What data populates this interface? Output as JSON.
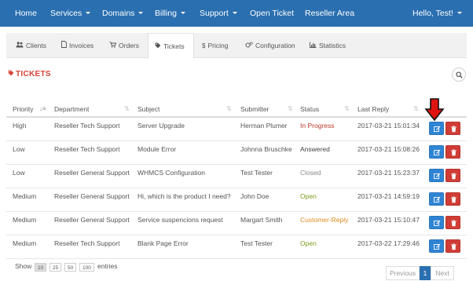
{
  "navbar": {
    "items": [
      {
        "label": "Home"
      },
      {
        "label": "Services"
      },
      {
        "label": "Domains"
      },
      {
        "label": "Billing"
      },
      {
        "label": "Support"
      },
      {
        "label": "Open Ticket"
      },
      {
        "label": "Reseller Area"
      }
    ],
    "user": "Hello, Test!",
    "color": "#2a6fb0"
  },
  "tabs": [
    {
      "label": "Clients",
      "icon": "users-icon"
    },
    {
      "label": "Invoices",
      "icon": "file-icon"
    },
    {
      "label": "Orders",
      "icon": "cart-icon"
    },
    {
      "label": "Tickets",
      "icon": "tag-icon",
      "active": true
    },
    {
      "label": "Pricing",
      "icon": "dollar-icon"
    },
    {
      "label": "Configuration",
      "icon": "cogs-icon"
    },
    {
      "label": "Statistics",
      "icon": "bar-chart-icon"
    }
  ],
  "section": {
    "title": "TICKETS",
    "title_icon": "tag-icon",
    "accent": "#d9433b"
  },
  "table": {
    "columns": [
      "Priority",
      "Department",
      "Subject",
      "Submitter",
      "Status",
      "Last Reply"
    ],
    "rows": [
      {
        "priority": "High",
        "department": "Reseller Tech Support",
        "subject": "Server Upgrade",
        "submitter": "Herman Plumer",
        "status": "In Progress",
        "last_reply": "2017-03-21 15:01:34"
      },
      {
        "priority": "Low",
        "department": "Reseller Tech Support",
        "subject": "Module Error",
        "submitter": "Johnna Bruschke",
        "status": "Answered",
        "last_reply": "2017-03-21 15:08:26"
      },
      {
        "priority": "Low",
        "department": "Reseller General Support",
        "subject": "WHMCS Configuration",
        "submitter": "Test Tester",
        "status": "Closed",
        "last_reply": "2017-03-21 15:23:37"
      },
      {
        "priority": "Medium",
        "department": "Reseller General Support",
        "subject": "Hi, which is the product I need?",
        "submitter": "John Doe",
        "status": "Open",
        "last_reply": "2017-03-21 14:59:19"
      },
      {
        "priority": "Medium",
        "department": "Reseller General Support",
        "subject": "Service suspencions request",
        "submitter": "Margart Smith",
        "status": "Customer-Reply",
        "last_reply": "2017-03-21 15:10:47"
      },
      {
        "priority": "Medium",
        "department": "Reseller Tech Support",
        "subject": "Blank Page Error",
        "submitter": "Test Tester",
        "status": "Open",
        "last_reply": "2017-03-22 17:29:46"
      }
    ],
    "status_colors": {
      "In Progress": "#c0392b",
      "Answered": "#444444",
      "Closed": "#888888",
      "Open": "#7a9a1a",
      "Customer-Reply": "#e08a1e"
    }
  },
  "footer": {
    "show_label": "Show",
    "lengths": [
      "10",
      "25",
      "50",
      "100"
    ],
    "active_length": "10",
    "entries_label": "entries",
    "pagination": {
      "previous": "Previous",
      "current": "1",
      "next": "Next"
    }
  }
}
